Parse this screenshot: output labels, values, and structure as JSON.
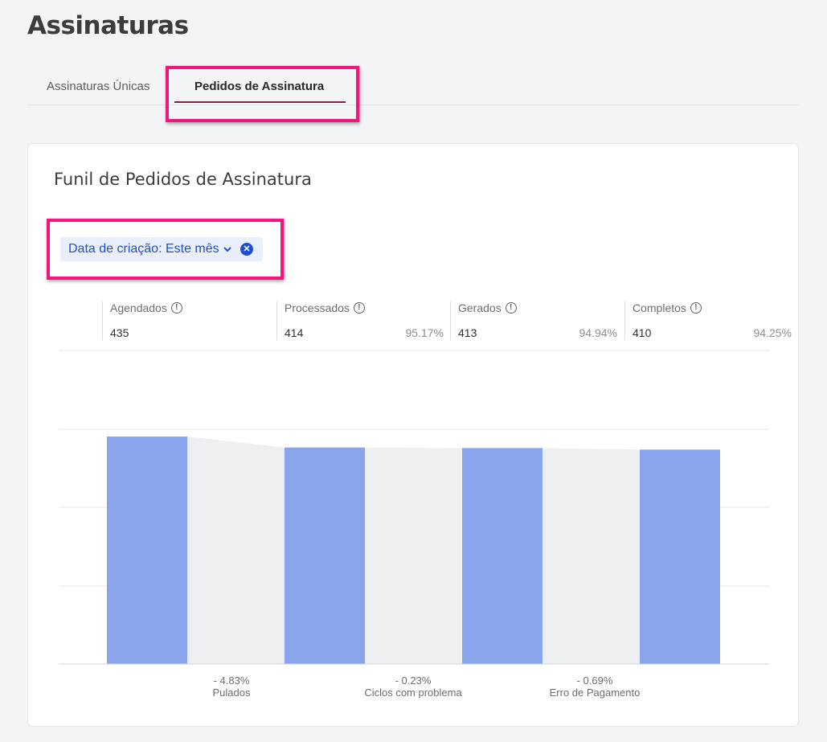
{
  "page": {
    "title": "Assinaturas"
  },
  "tabs": [
    {
      "label": "Assinaturas Únicas",
      "active": false
    },
    {
      "label": "Pedidos de Assinatura",
      "active": true
    }
  ],
  "card": {
    "title": "Funil de Pedidos de Assinatura",
    "filter": {
      "label": "Data de criação: Este mês",
      "icon": "chevron-down-icon",
      "clear_icon": "close-circle-icon"
    }
  },
  "stats": [
    {
      "label": "Agendados",
      "value": "435",
      "pct": ""
    },
    {
      "label": "Processados",
      "value": "414",
      "pct": "95.17%"
    },
    {
      "label": "Gerados",
      "value": "413",
      "pct": "94.94%"
    },
    {
      "label": "Completos",
      "value": "410",
      "pct": "94.25%"
    }
  ],
  "drops": [
    {
      "pct": "- 4.83%",
      "label": "Pulados"
    },
    {
      "pct": "- 0.23%",
      "label": "Ciclos com problema"
    },
    {
      "pct": "- 0.69%",
      "label": "Erro de Pagamento"
    }
  ],
  "colors": {
    "bar": "#8ba5ec",
    "bridge": "#eeeff1",
    "accent": "#8b1d45",
    "highlight": "#f2157e",
    "chip_text": "#1f4fd1"
  },
  "chart_data": {
    "type": "bar",
    "categories": [
      "Agendados",
      "Processados",
      "Gerados",
      "Completos"
    ],
    "values": [
      435,
      414,
      413,
      410
    ],
    "ylim": [
      0,
      450
    ],
    "grid": true
  }
}
